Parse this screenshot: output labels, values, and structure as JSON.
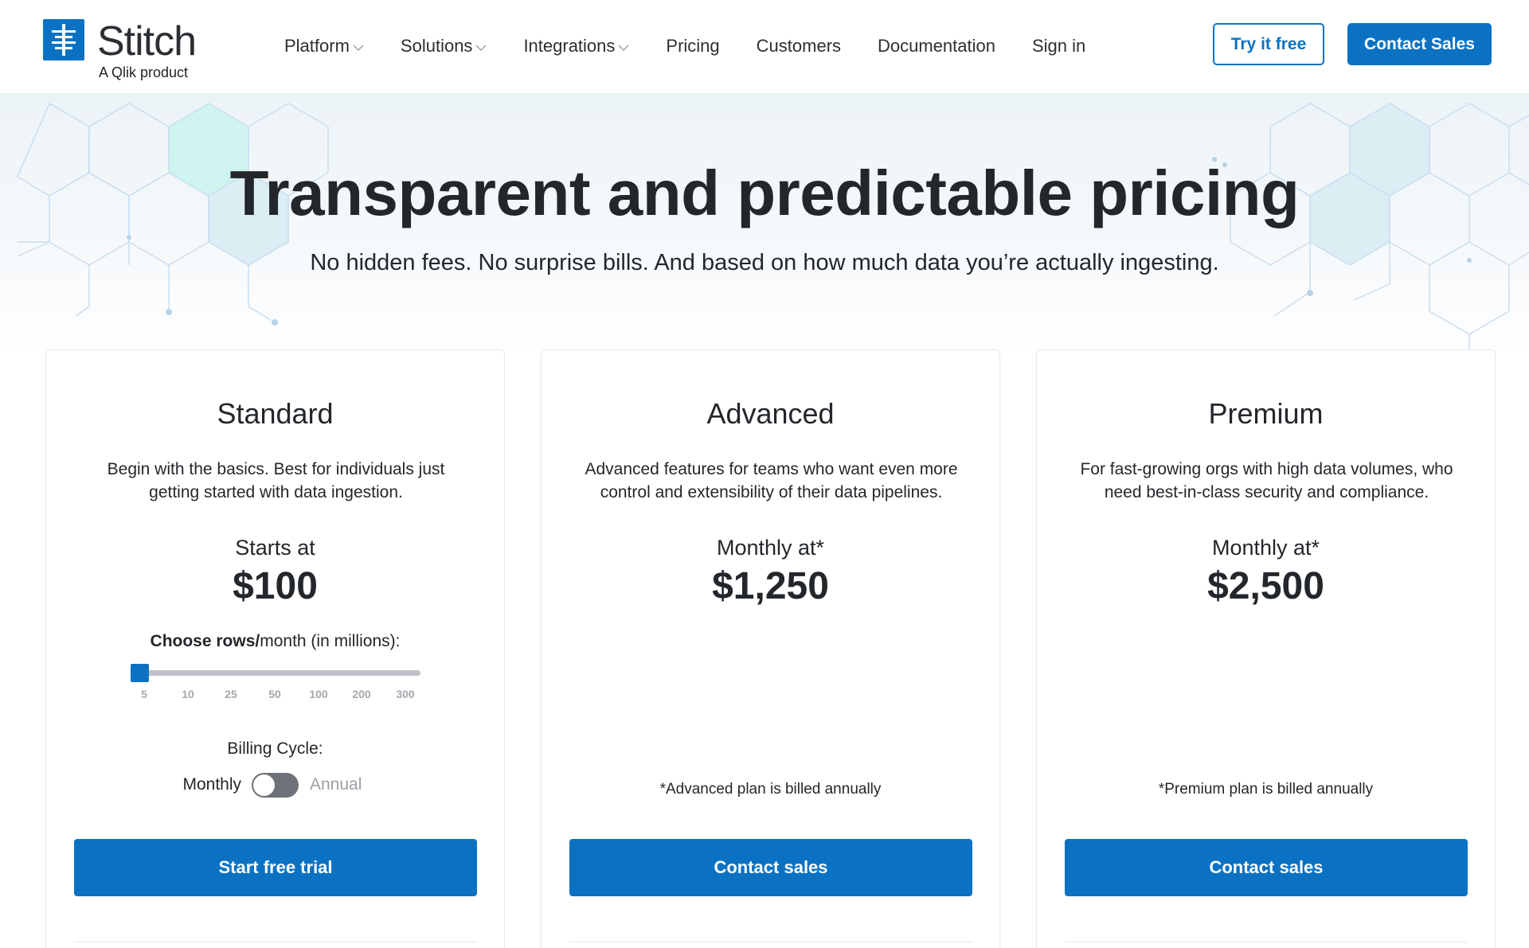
{
  "brand": {
    "name": "Stitch",
    "tagline": "A Qlik product",
    "accent_color": "#0b72c3"
  },
  "nav": {
    "items": [
      {
        "label": "Platform",
        "has_dropdown": true
      },
      {
        "label": "Solutions",
        "has_dropdown": true
      },
      {
        "label": "Integrations",
        "has_dropdown": true
      },
      {
        "label": "Pricing",
        "has_dropdown": false
      },
      {
        "label": "Customers",
        "has_dropdown": false
      },
      {
        "label": "Documentation",
        "has_dropdown": false
      },
      {
        "label": "Sign in",
        "has_dropdown": false
      }
    ],
    "try_free_label": "Try it free",
    "contact_sales_label": "Contact Sales"
  },
  "hero": {
    "title": "Transparent and predictable pricing",
    "subtitle": "No hidden fees. No surprise bills. And based on how much data you’re actually ingesting."
  },
  "plans": [
    {
      "name": "Standard",
      "description": "Begin with the basics. Best for individuals just getting started with data ingestion.",
      "price_label": "Starts at",
      "price": "$100",
      "rows_label_bold": "Choose rows/",
      "rows_label_rest": "month (in millions):",
      "slider_ticks": [
        "5",
        "10",
        "25",
        "50",
        "100",
        "200",
        "300"
      ],
      "slider_selected": "5",
      "billing_label": "Billing Cycle:",
      "billing_monthly": "Monthly",
      "billing_annual": "Annual",
      "billing_selected": "Monthly",
      "cta": "Start free trial"
    },
    {
      "name": "Advanced",
      "description": "Advanced features for teams who want even more control and extensibility of their data pipelines.",
      "price_label": "Monthly at*",
      "price": "$1,250",
      "note": "*Advanced plan is billed annually",
      "cta": "Contact sales"
    },
    {
      "name": "Premium",
      "description": "For fast-growing orgs with high data volumes, who need best-in-class security and compliance.",
      "price_label": "Monthly at*",
      "price": "$2,500",
      "note": "*Premium plan is billed annually",
      "cta": "Contact sales"
    }
  ]
}
